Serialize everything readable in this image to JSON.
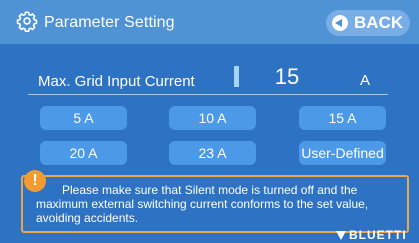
{
  "header": {
    "title": "Parameter Setting",
    "back_label": "BACK",
    "icon": "gear-icon"
  },
  "setting": {
    "label": "Max. Grid Input Current",
    "value": "15",
    "unit": "A"
  },
  "options": [
    {
      "label": "5 A"
    },
    {
      "label": "10 A"
    },
    {
      "label": "15 A"
    },
    {
      "label": "20 A"
    },
    {
      "label": "23 A"
    },
    {
      "label": "User-Defined"
    }
  ],
  "warning": {
    "icon": "!",
    "text": "Please make sure that Silent mode is turned off and the maximum external switching current conforms to the set value, avoiding accidents."
  },
  "brand": {
    "name": "BLUETTI"
  },
  "colors": {
    "background": "#2d72c3",
    "header": "#4f93d5",
    "button": "#4c99e8",
    "warning_border": "#e9a64a",
    "warning_icon": "#f39a31"
  }
}
